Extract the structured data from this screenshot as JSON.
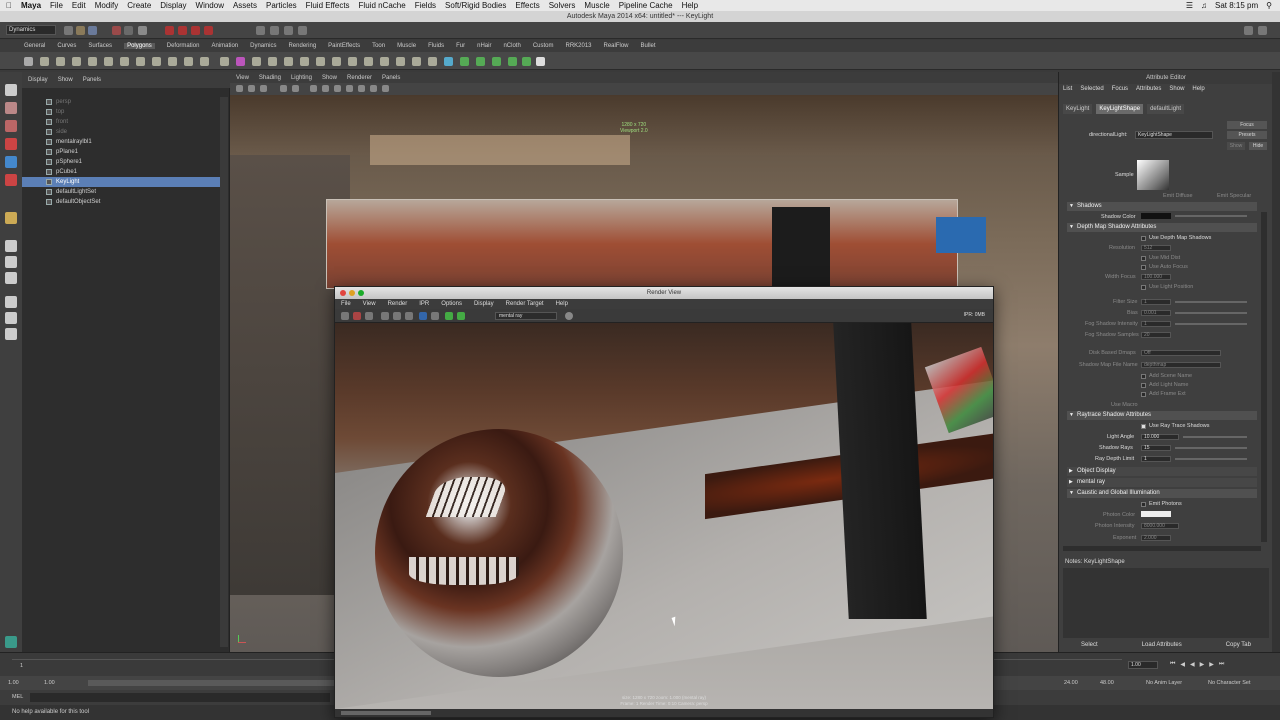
{
  "mac_menu": {
    "app": "Maya",
    "items": [
      "File",
      "Edit",
      "Modify",
      "Create",
      "Display",
      "Window",
      "Assets",
      "Particles",
      "Fluid Effects",
      "Fluid nCache",
      "Fields",
      "Soft/Rigid Bodies",
      "Effects",
      "Solvers",
      "Muscle",
      "Pipeline Cache",
      "Help"
    ],
    "clock": "Sat 8:15 pm"
  },
  "window_title": "Autodesk Maya 2014 x64: untitled*   ---   KeyLight",
  "status_line": {
    "mode": "Dynamics"
  },
  "shelf_tabs": [
    "General",
    "Curves",
    "Surfaces",
    "Polygons",
    "Deformation",
    "Animation",
    "Dynamics",
    "Rendering",
    "PaintEffects",
    "Toon",
    "Muscle",
    "Fluids",
    "Fur",
    "nHair",
    "nCloth",
    "Custom",
    "RRK2013",
    "RealFlow",
    "Bullet"
  ],
  "shelf_active": "Polygons",
  "outliner": {
    "menu": [
      "Display",
      "Show",
      "Panels"
    ],
    "items": [
      {
        "label": "persp",
        "state": "dim"
      },
      {
        "label": "top",
        "state": "dim"
      },
      {
        "label": "front",
        "state": "dim"
      },
      {
        "label": "side",
        "state": "dim"
      },
      {
        "label": "mentalraylbl1",
        "state": "normal"
      },
      {
        "label": "pPlane1",
        "state": "normal"
      },
      {
        "label": "pSphere1",
        "state": "normal"
      },
      {
        "label": "pCube1",
        "state": "normal"
      },
      {
        "label": "KeyLight",
        "state": "selected"
      },
      {
        "label": "defaultLightSet",
        "state": "normal"
      },
      {
        "label": "defaultObjectSet",
        "state": "normal"
      }
    ]
  },
  "viewport": {
    "menu": [
      "View",
      "Shading",
      "Lighting",
      "Show",
      "Renderer",
      "Panels"
    ],
    "hud_line1": "1280 x 720",
    "hud_line2": "Viewport 2.0"
  },
  "render_view": {
    "title": "Render View",
    "menu": [
      "File",
      "View",
      "Render",
      "IPR",
      "Options",
      "Display",
      "Render Target",
      "Help"
    ],
    "renderer": "mental ray",
    "ipr": "IPR: 0MB",
    "footer_line1": "size: 1280 x 720  zoom: 1.000       (mental ray)",
    "footer_line2": "Frame: 1      Render Time: 0:10      Camera: persp"
  },
  "attribute_editor": {
    "header": "Attribute Editor",
    "menu": [
      "List",
      "Selected",
      "Focus",
      "Attributes",
      "Show",
      "Help"
    ],
    "tabs": [
      "KeyLight",
      "KeyLightShape",
      "defaultLight"
    ],
    "active_tab": "KeyLightShape",
    "node_label": "directionalLight:",
    "node_value": "KeyLightShape",
    "focus_btn": "Focus",
    "presets_btn": "Presets",
    "show_btn": "Show",
    "hide_btn": "Hide",
    "sample_label": "Sample",
    "emit_diffuse": "Emit Diffuse",
    "emit_specular": "Emit Specular",
    "sections": {
      "shadows": "Shadows",
      "shadow_color": "Shadow Color",
      "depth_map": "Depth Map Shadow Attributes",
      "use_depth_map": "Use Depth Map Shadows",
      "resolution": "Resolution",
      "resolution_val": "512",
      "use_mid_dist": "Use Mid Dist",
      "use_auto_focus": "Use Auto Focus",
      "width_focus": "Width Focus",
      "width_focus_val": "100.000",
      "use_light_position": "Use Light Position",
      "filter_size": "Filter Size",
      "filter_size_val": "1",
      "bias": "Bias",
      "bias_val": "0.001",
      "fog_shadow_intensity": "Fog Shadow Intensity",
      "fog_shadow_intensity_val": "1",
      "fog_shadow_samples": "Fog Shadow Samples",
      "fog_shadow_samples_val": "20",
      "disk_based": "Disk Based Dmaps",
      "disk_based_val": "Off",
      "shadow_map_file": "Shadow Map File Name",
      "shadow_map_file_val": "depthmap",
      "add_scene_name": "Add Scene Name",
      "add_light_name": "Add Light Name",
      "add_frame_ext": "Add Frame Ext",
      "use_macro": "Use Macro",
      "raytrace": "Raytrace Shadow Attributes",
      "use_ray_trace": "Use Ray Trace Shadows",
      "light_angle": "Light Angle",
      "light_angle_val": "10.000",
      "shadow_rays": "Shadow Rays",
      "shadow_rays_val": "15",
      "ray_depth_limit": "Ray Depth Limit",
      "ray_depth_limit_val": "1",
      "object_display": "Object Display",
      "mental_ray": "mental ray",
      "caustic": "Caustic and Global Illumination",
      "emit_photons": "Emit Photons",
      "photon_color": "Photon Color",
      "photon_intensity": "Photon Intensity",
      "photon_intensity_val": "8000.000",
      "exponent": "Exponent",
      "exponent_val": "2.000"
    },
    "notes": "Notes:  KeyLightShape",
    "buttons": [
      "Select",
      "Load Attributes",
      "Copy Tab"
    ]
  },
  "timeline": {
    "start": "1",
    "current": "1.00",
    "range_start": "1.00",
    "range_start2": "1.00",
    "range_end": "24.00",
    "range_end2": "48.00",
    "anim_layer": "No Anim Layer",
    "char_set": "No Character Set",
    "mel": "MEL"
  },
  "help_line": "No help available for this tool",
  "colors": {
    "selection": "#5b7fb6",
    "panel": "#3f3f3f",
    "menubar": "#e8e8e8"
  }
}
